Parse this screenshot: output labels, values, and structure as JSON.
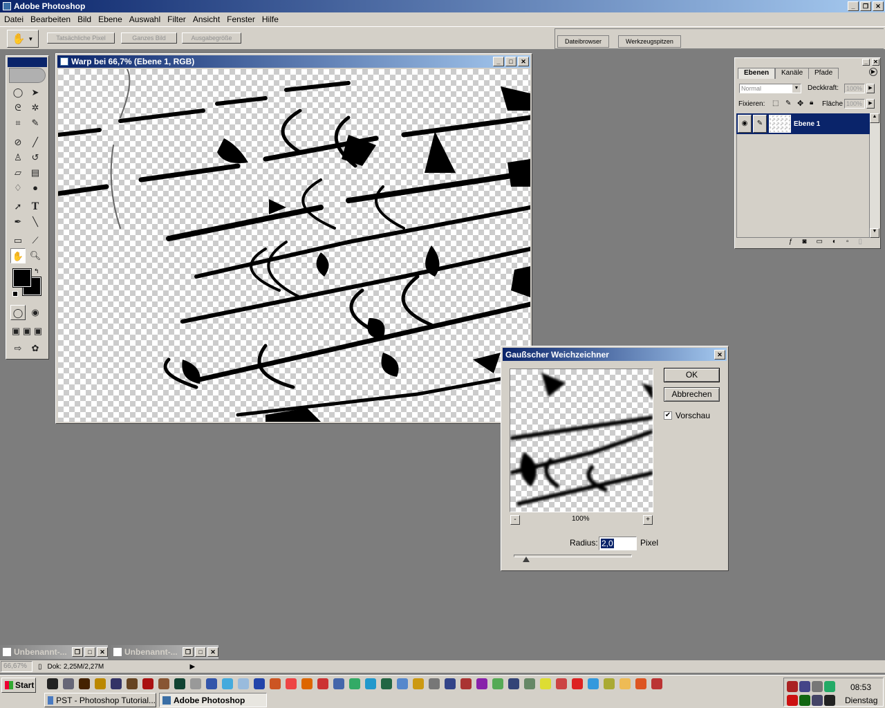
{
  "app": {
    "title": "Adobe Photoshop",
    "menu": [
      "Datei",
      "Bearbeiten",
      "Bild",
      "Ebene",
      "Auswahl",
      "Filter",
      "Ansicht",
      "Fenster",
      "Hilfe"
    ]
  },
  "options_bar": {
    "buttons": [
      "Tatsächliche Pixel",
      "Ganzes Bild",
      "Ausgabegröße"
    ],
    "well_tabs": [
      "Dateibrowser",
      "Werkzeugspitzen"
    ]
  },
  "document": {
    "title": "Warp bei 66,7% (Ebene 1, RGB)"
  },
  "layers_palette": {
    "tabs": [
      "Ebenen",
      "Kanäle",
      "Pfade"
    ],
    "blend_mode": "Normal",
    "opacity_label": "Deckkraft:",
    "opacity_value": "100%",
    "lock_label": "Fixieren:",
    "fill_label": "Fläche",
    "fill_value": "100%",
    "layer_name": "Ebene 1"
  },
  "dialog": {
    "title": "Gaußscher Weichzeichner",
    "ok": "OK",
    "cancel": "Abbrechen",
    "preview_label": "Vorschau",
    "preview_checked": true,
    "zoom": "100%",
    "zoom_minus": "-",
    "zoom_plus": "+",
    "radius_label": "Radius:",
    "radius_value": "2,0",
    "radius_unit": "Pixel"
  },
  "minimized_windows": [
    "Unbenannt-...",
    "Unbenannt-..."
  ],
  "status_bar": {
    "zoom": "66,67%",
    "doc_info": "Dok: 2,25M/2,27M"
  },
  "taskbar": {
    "start": "Start",
    "tasks": [
      "PST - Photoshop Tutorial...",
      "Adobe Photoshop"
    ],
    "time": "08:53",
    "day": "Dienstag"
  },
  "colors": {
    "title_active": "#0a246a",
    "title_gradient_end": "#a6caf0",
    "chrome": "#d4d0c8",
    "workspace": "#7d7d7d"
  }
}
